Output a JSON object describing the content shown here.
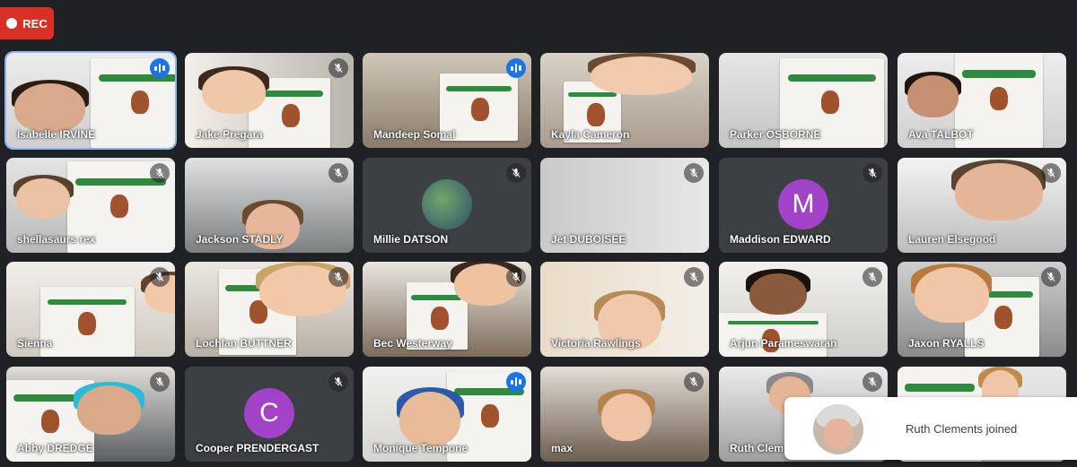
{
  "recording": {
    "label": "REC",
    "color": "#d93025"
  },
  "icons": {
    "muted": "mic-off-icon",
    "speaking": "audio-level-icon"
  },
  "tiles": [
    {
      "name": "Isabelle IRVINE",
      "mic": "speaking"
    },
    {
      "name": "Jake Pregara",
      "mic": "muted"
    },
    {
      "name": "Mandeep Somal",
      "mic": "speaking"
    },
    {
      "name": "Kayla Cameron",
      "mic": "none"
    },
    {
      "name": "Parker OSBORNE",
      "mic": "none"
    },
    {
      "name": "Ava TALBOT",
      "mic": "none"
    },
    {
      "name": "shellasaurs rex",
      "mic": "muted"
    },
    {
      "name": "Jackson STADLY",
      "mic": "muted"
    },
    {
      "name": "Millie DATSON",
      "mic": "muted"
    },
    {
      "name": "Jet DUBOISEE",
      "mic": "muted"
    },
    {
      "name": "Maddison EDWARD",
      "mic": "muted",
      "initial": "M",
      "avatar_color": "#a142c9"
    },
    {
      "name": "Lauren Elsegood",
      "mic": "muted"
    },
    {
      "name": "Sienna",
      "mic": "muted"
    },
    {
      "name": "Lochlan BUTTNER",
      "mic": "muted"
    },
    {
      "name": "Bec Westerway",
      "mic": "muted"
    },
    {
      "name": "Victoria Rawlings",
      "mic": "muted"
    },
    {
      "name": "Arjun Parameswaran",
      "mic": "muted"
    },
    {
      "name": "Jaxon RYALLS",
      "mic": "muted"
    },
    {
      "name": "Abby DREDGE",
      "mic": "muted"
    },
    {
      "name": "Cooper PRENDERGAST",
      "mic": "muted",
      "initial": "C",
      "avatar_color": "#a142c9"
    },
    {
      "name": "Monique Tempone",
      "mic": "speaking"
    },
    {
      "name": "max",
      "mic": "muted"
    },
    {
      "name": "Ruth Clem",
      "mic": "muted"
    },
    {
      "name": "",
      "mic": "none"
    }
  ],
  "notification": {
    "text": "Ruth Clements joined"
  }
}
